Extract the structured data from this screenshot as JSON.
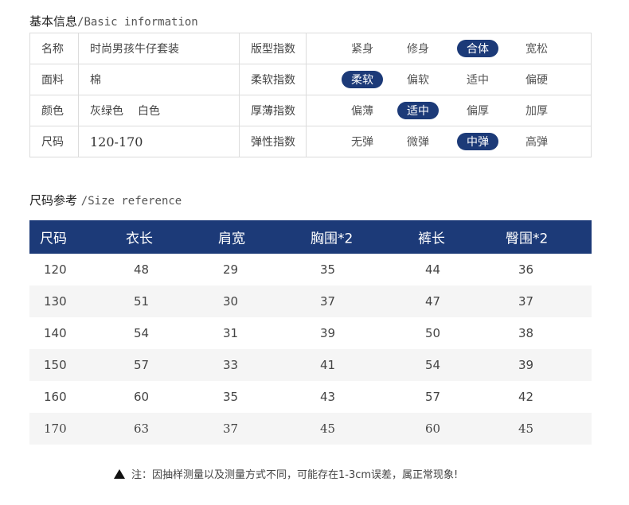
{
  "basic": {
    "title_cn": "基本信息",
    "title_en": "/Basic information",
    "name_label": "名称",
    "name_value": "时尚男孩牛仔套装",
    "fabric_label": "面料",
    "fabric_value": "棉",
    "color_label": "颜色",
    "color_values": [
      "灰绿色",
      "白色"
    ],
    "size_label": "尺码",
    "size_value": "120-170",
    "indices": [
      {
        "label": "版型指数",
        "options": [
          "紧身",
          "修身",
          "合体",
          "宽松"
        ],
        "selected": 2
      },
      {
        "label": "柔软指数",
        "options": [
          "柔软",
          "偏软",
          "适中",
          "偏硬"
        ],
        "selected": 0
      },
      {
        "label": "厚薄指数",
        "options": [
          "偏薄",
          "适中",
          "偏厚",
          "加厚"
        ],
        "selected": 1
      },
      {
        "label": "弹性指数",
        "options": [
          "无弹",
          "微弹",
          "中弹",
          "高弹"
        ],
        "selected": 2
      }
    ]
  },
  "size_ref": {
    "title_cn": "尺码参考",
    "title_en": "/Size reference",
    "headers": [
      "尺码",
      "衣长",
      "肩宽",
      "胸围*2",
      "裤长",
      "臀围*2"
    ],
    "rows": [
      [
        "120",
        "48",
        "29",
        "35",
        "44",
        "36"
      ],
      [
        "130",
        "51",
        "30",
        "37",
        "47",
        "37"
      ],
      [
        "140",
        "54",
        "31",
        "39",
        "50",
        "38"
      ],
      [
        "150",
        "57",
        "33",
        "41",
        "54",
        "39"
      ],
      [
        "160",
        "60",
        "35",
        "43",
        "57",
        "42"
      ],
      [
        "170",
        "63",
        "37",
        "45",
        "60",
        "45"
      ]
    ]
  },
  "note": {
    "text": "注：因抽样测量以及测量方式不同，可能存在1-3cm误差，属正常现象!"
  },
  "colors": {
    "accent": "#1c3a78",
    "row_alt": "#f5f5f5",
    "border": "#dcdcdc"
  }
}
